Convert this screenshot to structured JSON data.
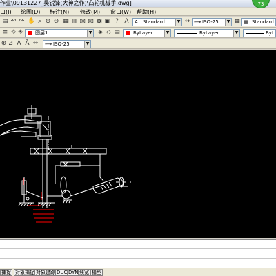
{
  "window": {
    "title": "作业\\09131227_吴锐锋(大神之作)\\凸轮机械手.dwg]",
    "badge": "73"
  },
  "menu": {
    "items": [
      {
        "label": "口(I)"
      },
      {
        "label": "绘图(D)"
      },
      {
        "label": "标注(N)"
      },
      {
        "label": "修改(M)"
      },
      {
        "label": "窗口(W)"
      },
      {
        "label": "帮助(H)"
      }
    ]
  },
  "toolbar1": {
    "text_style": "Standard",
    "dim_style": "ISO-25",
    "table_style": "Standard"
  },
  "toolbar2": {
    "layer": "图层1",
    "color": "ByLayer",
    "linetype": "ByLayer",
    "lineweight": "ByLayer"
  },
  "toolbar3": {
    "dim_style": "ISO-25"
  },
  "colors": {
    "canvas_bg": "#000000",
    "drawing_line": "#ffffff",
    "annotation": "#ff0000",
    "layer_color": "#ff0000"
  },
  "status": {
    "buttons": [
      {
        "label": "捕捉"
      },
      {
        "label": "对象捕捉"
      },
      {
        "label": "对象追踪"
      },
      {
        "label": "DUCS"
      },
      {
        "label": "DYN"
      },
      {
        "label": "线宽"
      },
      {
        "label": "模型"
      }
    ]
  }
}
